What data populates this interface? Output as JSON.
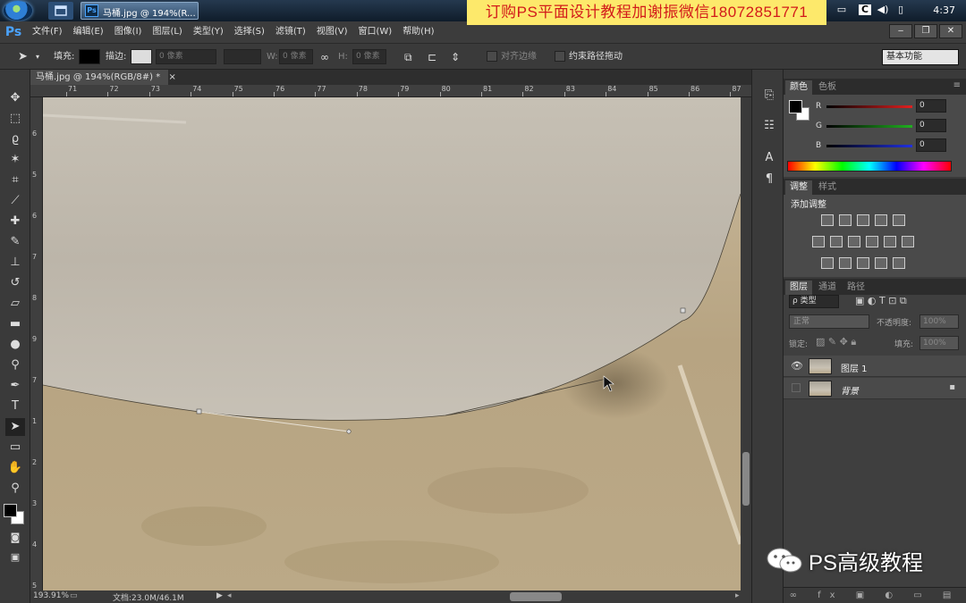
{
  "taskbar": {
    "ps_tab_label": "马桶.jpg @ 194%(R...",
    "clock": "4:37",
    "promo_text": "订购PS平面设计教程加谢振微信18072851771"
  },
  "menubar": {
    "logo": "Ps",
    "items": [
      "文件(F)",
      "编辑(E)",
      "图像(I)",
      "图层(L)",
      "类型(Y)",
      "选择(S)",
      "滤镜(T)",
      "视图(V)",
      "窗口(W)",
      "帮助(H)"
    ]
  },
  "options": {
    "fill_label": "填充:",
    "stroke_label": "描边:",
    "stroke_width_placeholder": "0 像素",
    "w_label": "W:",
    "w_value": "0 像素",
    "h_label": "H:",
    "h_value": "0 像素",
    "align_edges_label": "对齐边缘",
    "constrain_path_label": "约束路径拖动",
    "workspace": "基本功能"
  },
  "document": {
    "tab_title": "马桶.jpg @ 194%(RGB/8#) *",
    "ruler_top": [
      "71",
      "72",
      "73",
      "74",
      "75",
      "76",
      "77",
      "78",
      "79",
      "80",
      "81",
      "82",
      "83",
      "84",
      "85",
      "86",
      "87"
    ],
    "ruler_left": [
      "6",
      "5",
      "6",
      "7",
      "8",
      "9",
      "7",
      "1",
      "2",
      "3",
      "4",
      "5"
    ],
    "zoom": "193.91%",
    "doc_size": "文档:23.0M/46.1M"
  },
  "color_panel": {
    "tabs": [
      "颜色",
      "色板"
    ],
    "channels": [
      {
        "label": "R",
        "value": "0",
        "color": "#e02020"
      },
      {
        "label": "G",
        "value": "0",
        "color": "#20b020"
      },
      {
        "label": "B",
        "value": "0",
        "color": "#2030e0"
      }
    ]
  },
  "adjustments_panel": {
    "tabs": [
      "调整",
      "样式"
    ],
    "heading": "添加调整"
  },
  "layers_panel": {
    "tabs": [
      "图层",
      "通道",
      "路径"
    ],
    "filter_label": "ρ 类型",
    "blend_mode": "正常",
    "opacity_label": "不透明度:",
    "opacity_value": "100%",
    "lock_label": "锁定:",
    "fill_label": "填充:",
    "fill_value": "100%",
    "layers": [
      {
        "name": "图层 1",
        "visible": true
      },
      {
        "name": "背景",
        "visible": false,
        "locked": true
      }
    ]
  },
  "watermark": {
    "text": "PS高级教程",
    "icon": "wechat-icon"
  }
}
